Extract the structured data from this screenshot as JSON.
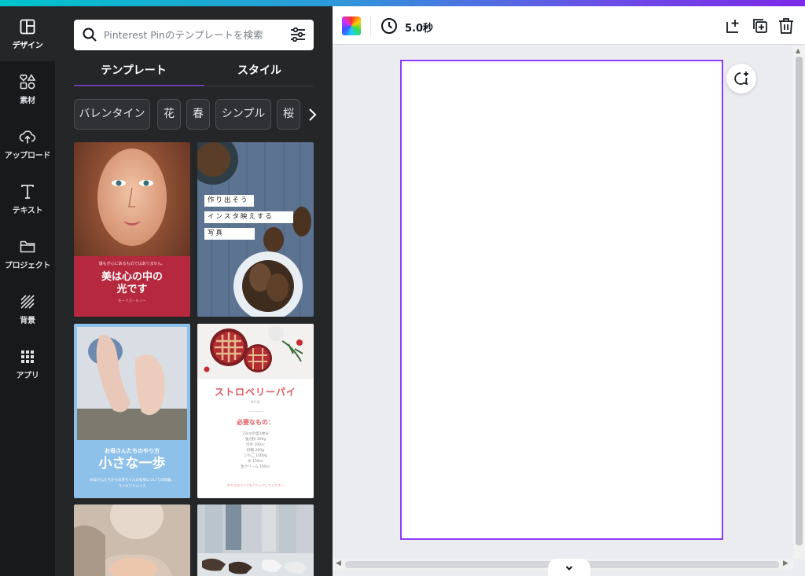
{
  "sidebar": {
    "items": [
      {
        "label": "デザイン"
      },
      {
        "label": "素材"
      },
      {
        "label": "アップロード"
      },
      {
        "label": "テキスト"
      },
      {
        "label": "プロジェクト"
      },
      {
        "label": "背景"
      },
      {
        "label": "アプリ"
      }
    ]
  },
  "panel": {
    "search_placeholder": "Pinterest Pinのテンプレートを検索",
    "tabs": [
      {
        "label": "テンプレート"
      },
      {
        "label": "スタイル"
      }
    ],
    "chips": [
      {
        "label": "バレンタイン"
      },
      {
        "label": "花"
      },
      {
        "label": "春"
      },
      {
        "label": "シンプル"
      },
      {
        "label": "桜"
      }
    ],
    "templates": {
      "t1": {
        "small": "誰もが心にあるものではありません。",
        "title_1": "美は心の中の",
        "title_2": "光です",
        "footer": "モーリス・ルノー"
      },
      "t2": {
        "lines": [
          "作り出そう",
          "インスタ映えする",
          "写真"
        ]
      },
      "t3": {
        "small": "お母さんたちのやり方",
        "title": "小さな一歩",
        "sub_1": "お母さんたちからの赤ちゃんの初歩についての経験、",
        "sub_2": "コツやアドバイス"
      },
      "t4": {
        "title": "ストロベリーパイ",
        "servings": "8人分",
        "heading": "必要なもの：",
        "ingredients": [
          "23cmの型1枚分",
          "強力粉 300g",
          "冷水 100cc",
          "砂糖 200g",
          "いちご 1000g",
          "水 150cc",
          "生クリーム 100cc"
        ],
        "footer": "作り方はリンクをクリックしてください"
      }
    }
  },
  "toolbar": {
    "timer_label": "5.0秒"
  },
  "colors": {
    "accent": "#8b3dff",
    "rail_bg": "#18191b",
    "panel_bg": "#252627",
    "canvas_bg": "#ebecf0"
  },
  "icons": {
    "sidebar": [
      "layout-icon",
      "shapes-icon",
      "cloud-upload-icon",
      "text-icon",
      "folder-icon",
      "pattern-icon",
      "apps-grid-icon"
    ],
    "toolbar": [
      "color-palette-icon",
      "clock-icon",
      "add-page-icon",
      "duplicate-page-icon",
      "trash-icon"
    ],
    "other": [
      "search-icon",
      "filter-icon",
      "chevron-right-icon",
      "chevron-left-icon",
      "chevron-down-icon",
      "comment-add-icon"
    ]
  }
}
